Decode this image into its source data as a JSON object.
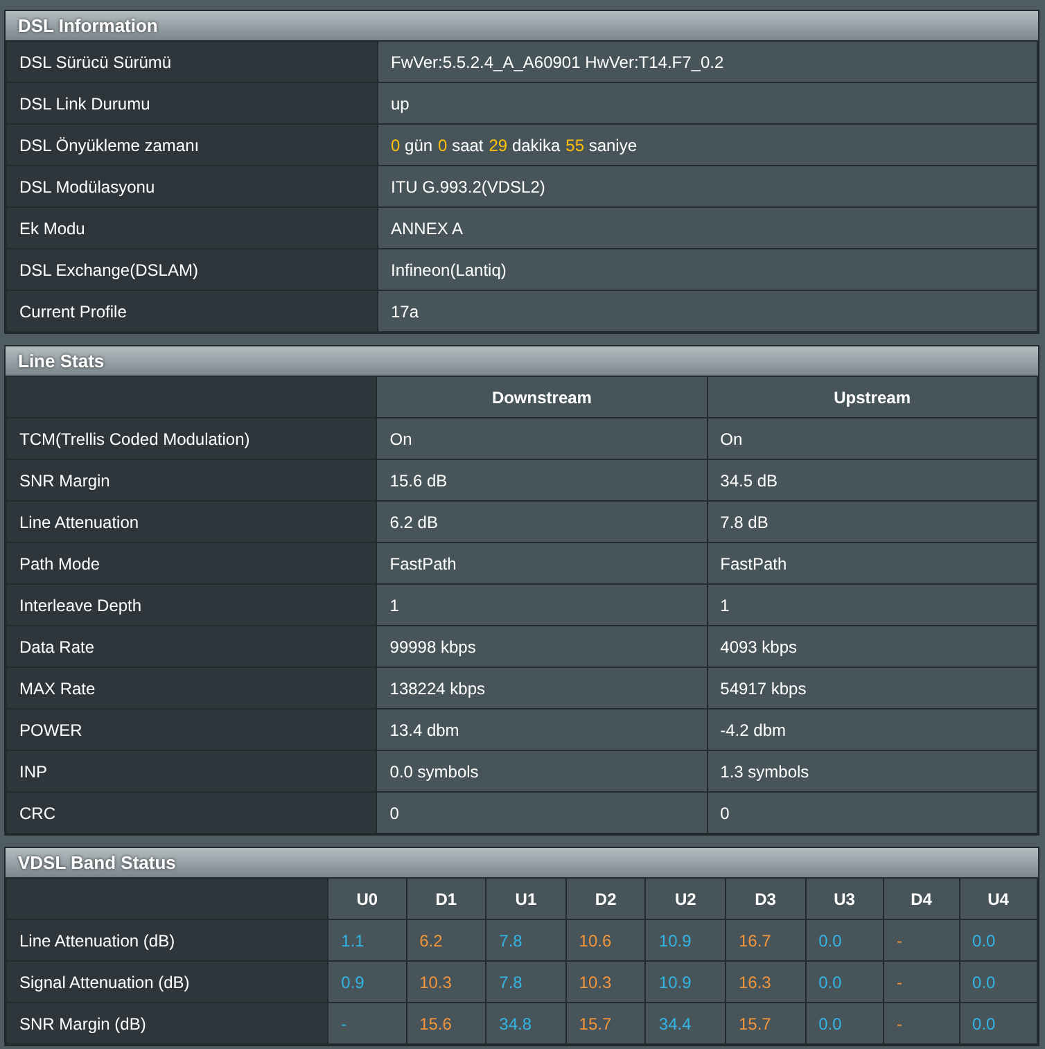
{
  "dsl_information": {
    "title": "DSL Information",
    "rows": [
      {
        "label": "DSL Sürücü Sürümü",
        "value": "FwVer:5.5.2.4_A_A60901 HwVer:T14.F7_0.2"
      },
      {
        "label": "DSL Link Durumu",
        "value": "up"
      },
      {
        "label": "DSL Önyükleme zamanı",
        "uptime": [
          {
            "number": "0",
            "unit": "gün"
          },
          {
            "number": "0",
            "unit": "saat"
          },
          {
            "number": "29",
            "unit": "dakika"
          },
          {
            "number": "55",
            "unit": "saniye"
          }
        ]
      },
      {
        "label": "DSL Modülasyonu",
        "value": "ITU G.993.2(VDSL2)"
      },
      {
        "label": "Ek Modu",
        "value": "ANNEX A"
      },
      {
        "label": "DSL Exchange(DSLAM)",
        "value": "Infineon(Lantiq)"
      },
      {
        "label": "Current Profile",
        "value": "17a"
      }
    ]
  },
  "line_stats": {
    "title": "Line Stats",
    "columns": [
      "Downstream",
      "Upstream"
    ],
    "rows": [
      {
        "label": "TCM(Trellis Coded Modulation)",
        "values": [
          "On",
          "On"
        ]
      },
      {
        "label": "SNR Margin",
        "values": [
          "15.6 dB",
          "34.5 dB"
        ]
      },
      {
        "label": "Line Attenuation",
        "values": [
          "6.2 dB",
          "7.8 dB"
        ]
      },
      {
        "label": "Path Mode",
        "values": [
          "FastPath",
          "FastPath"
        ]
      },
      {
        "label": "Interleave Depth",
        "values": [
          "1",
          "1"
        ]
      },
      {
        "label": "Data Rate",
        "values": [
          "99998 kbps",
          "4093 kbps"
        ]
      },
      {
        "label": "MAX Rate",
        "values": [
          "138224 kbps",
          "54917 kbps"
        ]
      },
      {
        "label": "POWER",
        "values": [
          "13.4 dbm",
          "-4.2 dbm"
        ]
      },
      {
        "label": "INP",
        "values": [
          "0.0 symbols",
          "1.3 symbols"
        ]
      },
      {
        "label": "CRC",
        "values": [
          "0",
          "0"
        ]
      }
    ]
  },
  "vdsl_band_status": {
    "title": "VDSL Band Status",
    "columns": [
      {
        "label": "U0",
        "color": "#33b5e5"
      },
      {
        "label": "D1",
        "color": "#f3953b"
      },
      {
        "label": "U1",
        "color": "#33b5e5"
      },
      {
        "label": "D2",
        "color": "#f3953b"
      },
      {
        "label": "U2",
        "color": "#33b5e5"
      },
      {
        "label": "D3",
        "color": "#f3953b"
      },
      {
        "label": "U3",
        "color": "#33b5e5"
      },
      {
        "label": "D4",
        "color": "#f3953b"
      },
      {
        "label": "U4",
        "color": "#33b5e5"
      }
    ],
    "rows": [
      {
        "label": "Line Attenuation (dB)",
        "values": [
          "1.1",
          "6.2",
          "7.8",
          "10.6",
          "10.9",
          "16.7",
          "0.0",
          "-",
          "0.0"
        ]
      },
      {
        "label": "Signal Attenuation (dB)",
        "values": [
          "0.9",
          "10.3",
          "7.8",
          "10.3",
          "10.9",
          "16.3",
          "0.0",
          "-",
          "0.0"
        ]
      },
      {
        "label": "SNR Margin (dB)",
        "values": [
          "-",
          "15.6",
          "34.8",
          "15.7",
          "34.4",
          "15.7",
          "0.0",
          "-",
          "0.0"
        ]
      }
    ]
  }
}
